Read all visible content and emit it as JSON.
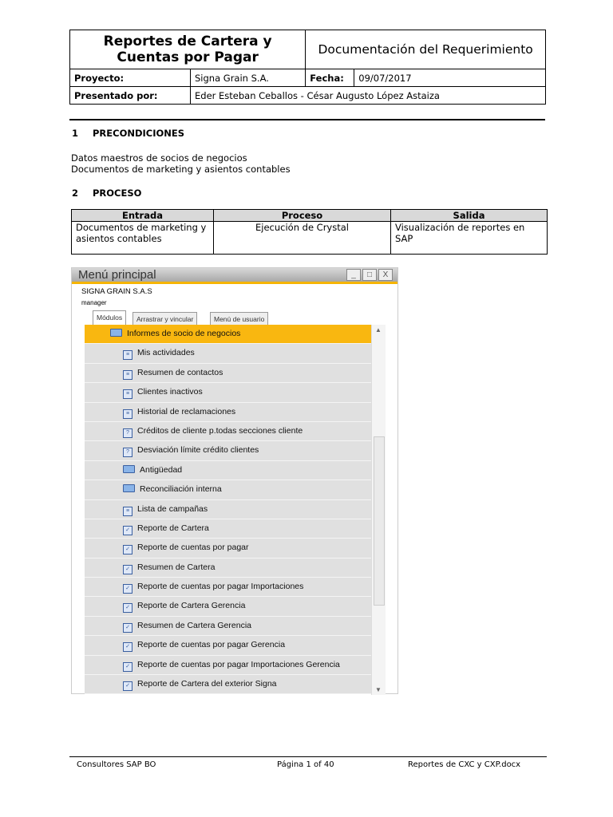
{
  "header": {
    "title": "Reportes de Cartera y Cuentas por Pagar",
    "doc_title": "Documentación del Requerimiento",
    "project_label": "Proyecto:",
    "project": "Signa Grain S.A.",
    "date_label": "Fecha:",
    "date": "09/07/2017",
    "presented_label": "Presentado por:",
    "presented": "Eder Esteban Ceballos - César Augusto López Astaiza"
  },
  "sections": [
    {
      "num": "1",
      "title": "PRECONDICIONES",
      "lines": [
        "Datos maestros de socios de negocios",
        "Documentos de marketing y asientos contables"
      ]
    },
    {
      "num": "2",
      "title": "PROCESO"
    }
  ],
  "process": {
    "headers": [
      "Entrada",
      "Proceso",
      "Salida"
    ],
    "row": [
      "Documentos de marketing y asientos contables",
      "Ejecución de Crystal",
      "Visualización de reportes en SAP"
    ]
  },
  "screenshot": {
    "title": "Menú principal",
    "company": "SIGNA GRAIN S.A.S",
    "user": "manager",
    "tabs": [
      "Módulos",
      "Arrastrar y vincular",
      "Menú de usuario"
    ],
    "folder": "Informes de socio de negocios",
    "items": [
      {
        "label": "Mis actividades",
        "icon": "doc"
      },
      {
        "label": "Resumen de contactos",
        "icon": "doc"
      },
      {
        "label": "Clientes inactivos",
        "icon": "doc"
      },
      {
        "label": "Historial de reclamaciones",
        "icon": "doc"
      },
      {
        "label": "Créditos de cliente p.todas secciones cliente",
        "icon": "query"
      },
      {
        "label": "Desviación límite crédito clientes",
        "icon": "query"
      },
      {
        "label": "Antigüedad",
        "icon": "folder"
      },
      {
        "label": "Reconciliación interna",
        "icon": "folder"
      },
      {
        "label": "Lista de campañas",
        "icon": "doc"
      },
      {
        "label": "Reporte de Cartera",
        "icon": "crystal"
      },
      {
        "label": "Reporte de cuentas por pagar",
        "icon": "crystal"
      },
      {
        "label": "Resumen de Cartera",
        "icon": "crystal"
      },
      {
        "label": "Reporte de cuentas por pagar Importaciones",
        "icon": "crystal"
      },
      {
        "label": "Reporte de Cartera Gerencia",
        "icon": "crystal"
      },
      {
        "label": "Resumen de Cartera Gerencia",
        "icon": "crystal"
      },
      {
        "label": "Reporte de cuentas por pagar Gerencia",
        "icon": "crystal"
      },
      {
        "label": "Reporte de cuentas por pagar Importaciones Gerencia",
        "icon": "crystal"
      },
      {
        "label": "Reporte de Cartera del exterior Signa",
        "icon": "crystal"
      }
    ]
  },
  "footer": {
    "left": "Consultores SAP BO",
    "center": "Página 1 of 40",
    "right": "Reportes de CXC y CXP.docx"
  }
}
